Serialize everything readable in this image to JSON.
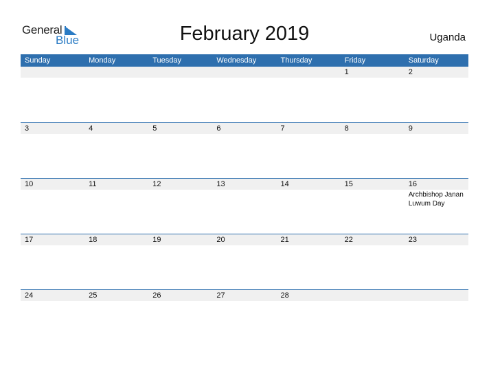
{
  "logo": {
    "text_general": "General",
    "text_blue": "Blue",
    "brand_color": "#2a7bc4"
  },
  "header": {
    "title": "February 2019",
    "country": "Uganda"
  },
  "calendar": {
    "accent_color": "#2e6fae",
    "weekdays": [
      "Sunday",
      "Monday",
      "Tuesday",
      "Wednesday",
      "Thursday",
      "Friday",
      "Saturday"
    ],
    "weeks": [
      {
        "days": [
          "",
          "",
          "",
          "",
          "",
          "1",
          "2"
        ],
        "events": [
          "",
          "",
          "",
          "",
          "",
          "",
          ""
        ]
      },
      {
        "days": [
          "3",
          "4",
          "5",
          "6",
          "7",
          "8",
          "9"
        ],
        "events": [
          "",
          "",
          "",
          "",
          "",
          "",
          ""
        ]
      },
      {
        "days": [
          "10",
          "11",
          "12",
          "13",
          "14",
          "15",
          "16"
        ],
        "events": [
          "",
          "",
          "",
          "",
          "",
          "",
          "Archbishop Janan Luwum Day"
        ]
      },
      {
        "days": [
          "17",
          "18",
          "19",
          "20",
          "21",
          "22",
          "23"
        ],
        "events": [
          "",
          "",
          "",
          "",
          "",
          "",
          ""
        ]
      },
      {
        "days": [
          "24",
          "25",
          "26",
          "27",
          "28",
          "",
          ""
        ],
        "events": [
          "",
          "",
          "",
          "",
          "",
          "",
          ""
        ]
      }
    ]
  }
}
